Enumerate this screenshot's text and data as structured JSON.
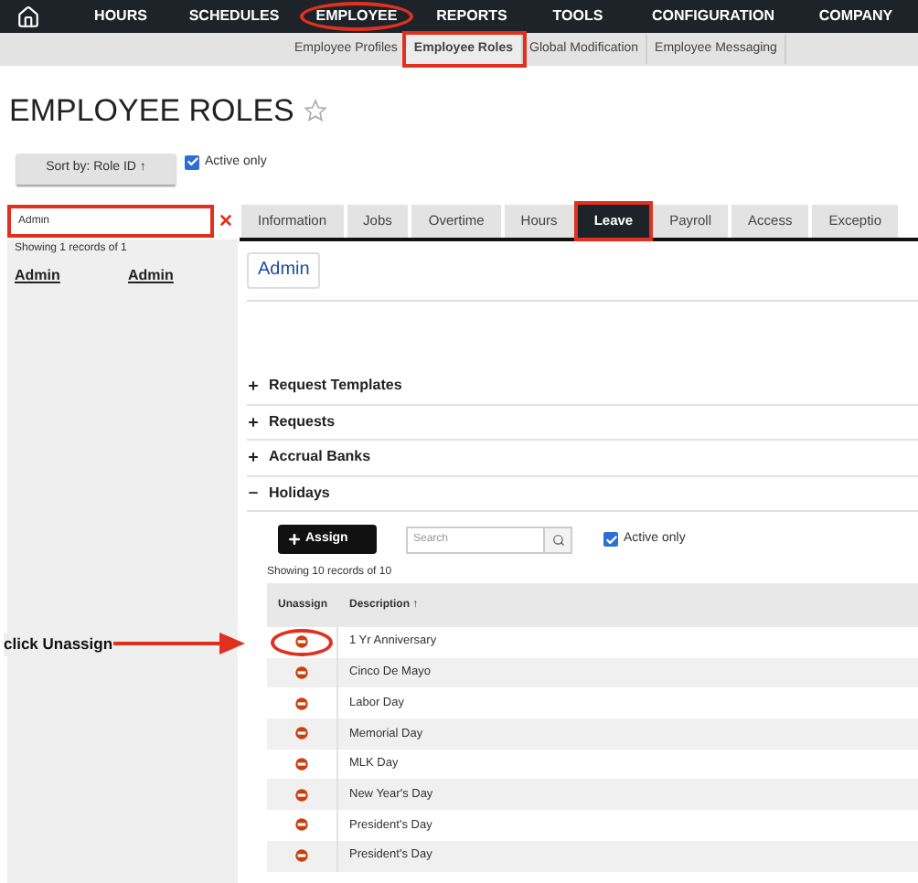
{
  "nav": {
    "items": [
      {
        "label": "HOURS",
        "highlighted": false
      },
      {
        "label": "SCHEDULES",
        "highlighted": false
      },
      {
        "label": "EMPLOYEE",
        "highlighted": true
      },
      {
        "label": "REPORTS",
        "highlighted": false
      },
      {
        "label": "TOOLS",
        "highlighted": false
      },
      {
        "label": "CONFIGURATION",
        "highlighted": false
      },
      {
        "label": "COMPANY",
        "highlighted": false
      }
    ]
  },
  "subnav": {
    "items": [
      {
        "label": "Employee Profiles",
        "selected": false,
        "highlighted": false
      },
      {
        "label": "Employee Roles",
        "selected": true,
        "highlighted": true
      },
      {
        "label": "Global Modification",
        "selected": false,
        "highlighted": false
      },
      {
        "label": "Employee Messaging",
        "selected": false,
        "highlighted": false
      }
    ]
  },
  "page_title": "EMPLOYEE ROLES",
  "sort_button": "Sort by: Role ID ↑",
  "active_only": {
    "label": "Active only",
    "checked": true
  },
  "search": {
    "value": "Admin",
    "highlighted": true
  },
  "list": {
    "summary": "Showing 1 records of 1",
    "rows": [
      {
        "column_1": "Admin",
        "column_2": "Admin"
      }
    ]
  },
  "tabs": [
    {
      "label": "Information",
      "selected": false,
      "highlighted": false
    },
    {
      "label": "Jobs",
      "selected": false,
      "highlighted": false
    },
    {
      "label": "Overtime",
      "selected": false,
      "highlighted": false
    },
    {
      "label": "Hours",
      "selected": false,
      "highlighted": false
    },
    {
      "label": "Leave",
      "selected": true,
      "highlighted": true
    },
    {
      "label": "Payroll",
      "selected": false,
      "highlighted": false
    },
    {
      "label": "Access",
      "selected": false,
      "highlighted": false
    },
    {
      "label": "Exceptio",
      "selected": false,
      "highlighted": false
    }
  ],
  "role_button": "Admin",
  "sections": [
    {
      "label": "Request Templates",
      "expanded": false
    },
    {
      "label": "Requests",
      "expanded": false
    },
    {
      "label": "Accrual Banks",
      "expanded": false
    },
    {
      "label": "Holidays",
      "expanded": true
    }
  ],
  "holidays": {
    "assign_button": "Assign",
    "search_placeholder": "Search",
    "active_only": {
      "label": "Active only",
      "checked": true
    },
    "summary": "Showing 10 records of 10",
    "columns": [
      "Unassign",
      "Description ↑"
    ],
    "rows": [
      {
        "description": "1 Yr Anniversary",
        "highlighted": true
      },
      {
        "description": "Cinco De Mayo",
        "highlighted": false
      },
      {
        "description": "Labor Day",
        "highlighted": false
      },
      {
        "description": "Memorial Day",
        "highlighted": false
      },
      {
        "description": "MLK Day",
        "highlighted": false
      },
      {
        "description": "New Year's Day",
        "highlighted": false
      },
      {
        "description": "President's Day",
        "highlighted": false
      },
      {
        "description": "President's Day",
        "highlighted": false
      }
    ]
  },
  "annotation": {
    "text": "click Unassign"
  }
}
